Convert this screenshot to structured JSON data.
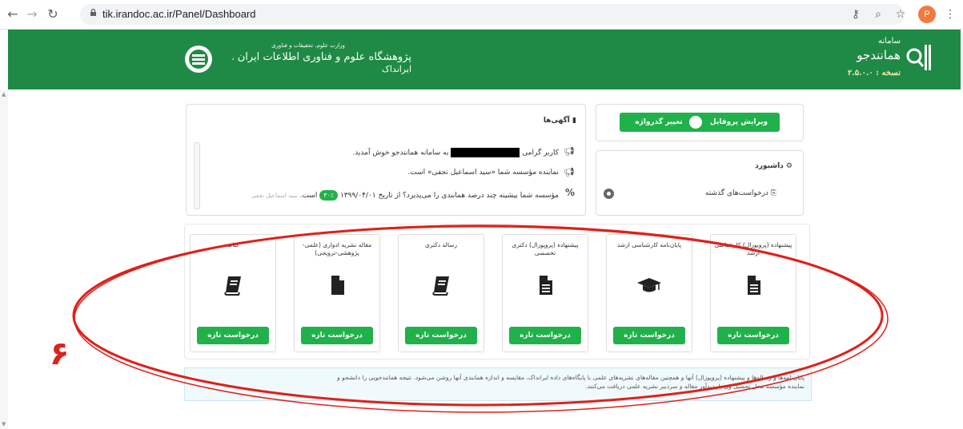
{
  "browser": {
    "url": "tik.irandoc.ac.ir/Panel/Dashboard",
    "avatar_letter": "P"
  },
  "header": {
    "logo_line1": "سامانه",
    "logo_line2": "همانندجو",
    "version": "نسخه : ۲.۵.۰.۰",
    "ministry": "وزارت علوم، تحقیقات و فناوری",
    "institute": "پژوهشگاه علوم و فناوری اطلاعات ایران",
    "institute_short": "ایرانداک"
  },
  "profile": {
    "edit_profile": "ویرایش پروفایل",
    "change_password": "تغییر گذرواژه"
  },
  "dashboard": {
    "title": "داشبورد",
    "past_requests": "درخواست‌های گذشته"
  },
  "announcements": {
    "title": "آگهی‌ها",
    "items": [
      {
        "before": "کاربر گرامی",
        "after": "به سامانه همانندجو خوش آمدید."
      },
      {
        "text": "نماینده مؤسسه شما «سید اسماعیل نجفی» است."
      },
      {
        "text": "مؤسسه شما بیشینه چند درصد همانندی را می‌پذیرد؟ از تاریخ ۱۳۹۹/۰۴/۰۱",
        "badge": "۳۰٪",
        "after": "است.",
        "author": "سید اسماعیل نجفی"
      }
    ]
  },
  "cards": [
    {
      "title": "پیشنهاده (پروپوزال) کارشناسی ارشد",
      "icon": "file-icon",
      "button": "درخواست تازه"
    },
    {
      "title": "پایان‌نامه کارشناسی ارشد",
      "icon": "graduation-cap-icon",
      "button": "درخواست تازه"
    },
    {
      "title": "پیشنهاده (پروپوزال) دکتری تخصصی",
      "icon": "file-icon",
      "button": "درخواست تازه"
    },
    {
      "title": "رساله دکتری",
      "icon": "book-icon",
      "button": "درخواست تازه"
    },
    {
      "title": "مقاله نشریه ادواری (علمی-پژوهشی-ترویجی)",
      "icon": "file-solid-icon",
      "button": "درخواست تازه"
    },
    {
      "title": "کتاب",
      "icon": "book-icon",
      "button": "درخواست تازه"
    }
  ],
  "info": {
    "line1": "پایان‌نامه‌ها و رساله‌ها و پیشنهاده (پروپوزال) آنها و همچنین مقاله‌های نشریه‌های علمی با پایگاه‌های داده ایرانداک، مقایسه و اندازه همانندی آنها روشن می‌شود. نتیجه همانندجویی را دانشجو و",
    "line2": "نماینده مؤسسه محل تحصیل وی یا پدیدآور مقاله و سردبیر نشریه علمی دریافت می‌کنند."
  },
  "annotation": {
    "label": "۶",
    "color": "#e0201a"
  },
  "colors": {
    "brand_green": "#1f8a45",
    "button_green": "#21b14b"
  }
}
